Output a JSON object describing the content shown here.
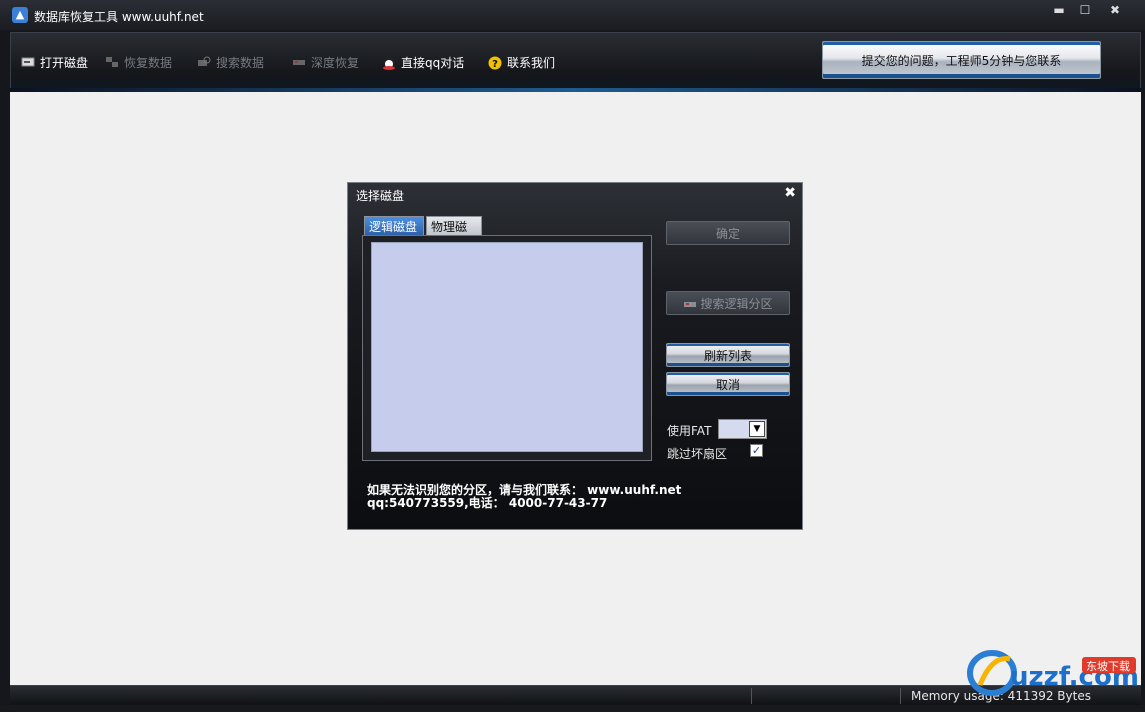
{
  "window": {
    "title": "数据库恢复工具 www.uuhf.net",
    "controls": {
      "minimize": "▬",
      "maximize": "☐",
      "close": "✖"
    }
  },
  "toolbar": {
    "items": [
      {
        "label": "打开磁盘",
        "icon": "disk-icon",
        "enabled": true
      },
      {
        "label": "恢复数据",
        "icon": "restore-icon",
        "enabled": false
      },
      {
        "label": "搜索数据",
        "icon": "search-data-icon",
        "enabled": false
      },
      {
        "label": "深度恢复",
        "icon": "deep-restore-icon",
        "enabled": false
      },
      {
        "label": "直接qq对话",
        "icon": "qq-icon",
        "enabled": true
      },
      {
        "label": "联系我们",
        "icon": "help-icon",
        "enabled": true
      }
    ],
    "contact_button": "提交您的问题，工程师5分钟与您联系"
  },
  "dialog": {
    "title": "选择磁盘",
    "close": "✖",
    "tabs": [
      {
        "label": "逻辑磁盘",
        "active": true
      },
      {
        "label": "物理磁盘",
        "active": false
      }
    ],
    "buttons": {
      "ok": "确定",
      "search_partition": "搜索逻辑分区",
      "refresh": "刷新列表",
      "cancel": "取消"
    },
    "use_fat_label": "使用FAT",
    "skip_bad_label": "跳过坏扇区",
    "skip_bad_checked": true,
    "notice_line1": "如果无法识别您的分区，请与我们联系：  www.uuhf.net",
    "notice_line2": "qq:540773559,电话： 4000-77-43-77"
  },
  "statusbar": {
    "memory": "Memory usage: 411392 Bytes"
  },
  "watermark": {
    "logo_text": "uzzf.com",
    "badge_text": "东坡下载"
  },
  "colors": {
    "accent_blue": "#1f5fa6",
    "listbox_bg": "#c6cdec",
    "main_bg": "#f0f0f0"
  }
}
